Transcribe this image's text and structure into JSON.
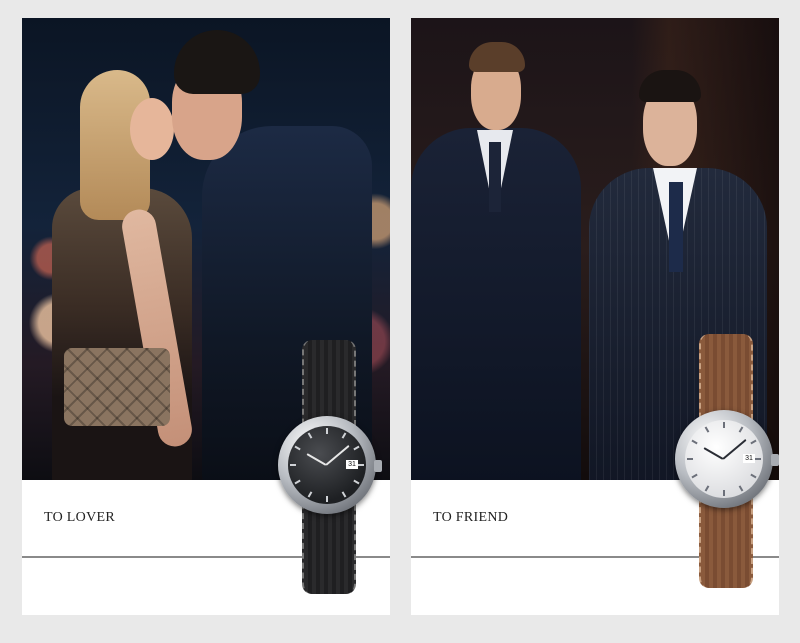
{
  "cards": [
    {
      "caption": "TO LOVER",
      "watch": {
        "dial": "black",
        "strap": "black",
        "date": "31"
      }
    },
    {
      "caption": "TO FRIEND",
      "watch": {
        "dial": "white",
        "strap": "brown",
        "date": "31"
      }
    }
  ],
  "colors": {
    "page_background": "#e9e9e9",
    "card_background": "#ffffff",
    "divider": "#8a8a8a"
  }
}
